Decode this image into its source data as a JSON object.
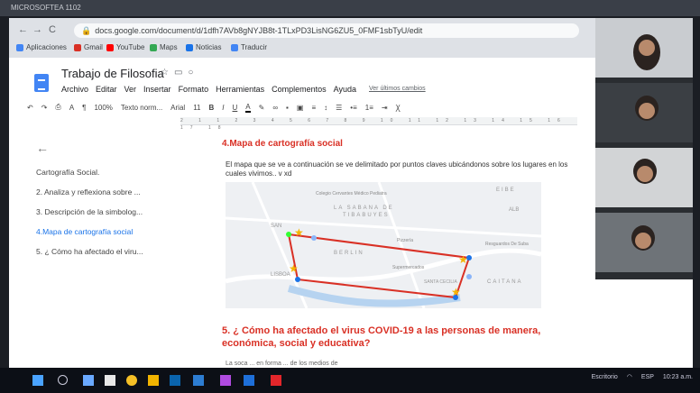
{
  "window": {
    "label": "MICROSOFTEA 1102"
  },
  "browser": {
    "url": "docs.google.com/document/d/1dfh7AVb8gNYJB8t-1TLxPD3LisNG6ZU5_0FMF1sbTyU/edit",
    "bookmarks": [
      "Aplicaciones",
      "Gmail",
      "YouTube",
      "Maps",
      "Noticias",
      "Traducir"
    ]
  },
  "doc": {
    "title": "Trabajo de Filosofia",
    "menu": [
      "Archivo",
      "Editar",
      "Ver",
      "Insertar",
      "Formato",
      "Herramientas",
      "Complementos",
      "Ayuda"
    ],
    "last_edit": "Ver últimos cambios",
    "toolbar": {
      "zoom": "100%",
      "style": "Texto norm...",
      "font": "Arial",
      "size": "11"
    },
    "ruler": "2 1 1 2 3 4 5 6 7 8 9 10 11 12 13 14 15 16 17 18"
  },
  "outline": {
    "items": [
      "Cartografía Social.",
      "2. Analiza y reflexiona sobre ...",
      "3. Descripción de la simbolog...",
      "4.Mapa de cartografía social",
      "5. ¿ Cómo ha afectado el viru..."
    ]
  },
  "page": {
    "heading4": "4.Mapa de  cartografía social",
    "paragraph": "El mapa que se ve a continuación se ve delimitado por puntos claves ubicándonos sobre los lugares en los cuales vivimos..  v xd",
    "map_labels": [
      "Colegio Cervantes Médico Pediatra",
      "LA SABANA DE",
      "TIBABUYES",
      "SAN",
      "BERLIN",
      "LISBOA",
      "Pizzería",
      "Resguardos De Suba",
      "Supermercados",
      "SANTA CECILIA",
      "CAITANA",
      "EIBE",
      "ALB"
    ],
    "heading5": "5. ¿ Cómo ha afectado el virus COVID-19 a las personas de manera, económica, social y educativa?",
    "cut_line": "La soca ... en forma ... de los medios de"
  },
  "taskbar": {
    "app_label": "Escritorio",
    "lang": "ESP",
    "time": "10:23 a.m."
  }
}
